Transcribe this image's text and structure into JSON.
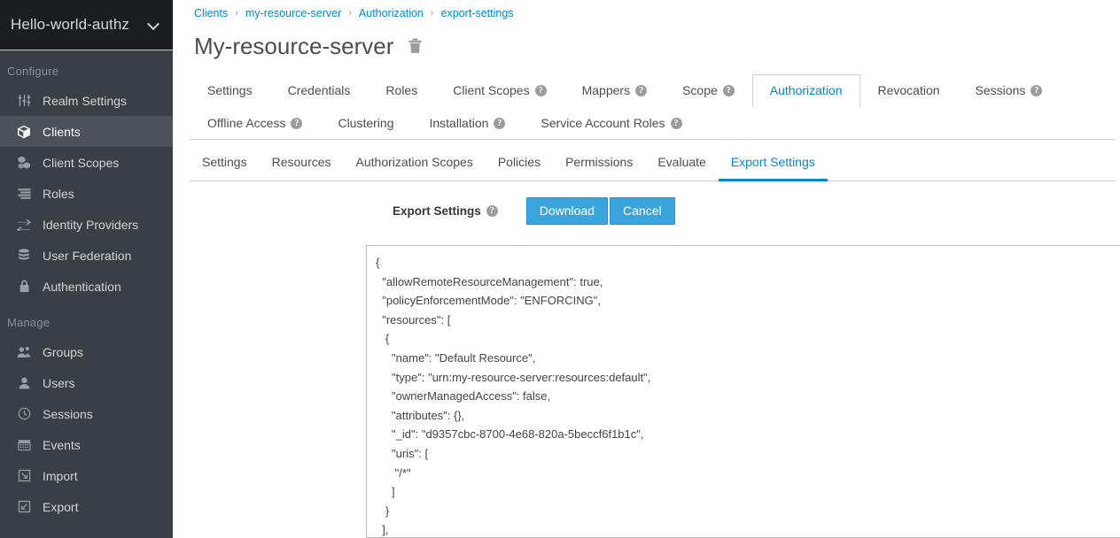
{
  "sidebar": {
    "realm": {
      "name": "Hello-world-authz",
      "chevron_icon": "chevron-down-icon"
    },
    "sections": [
      {
        "label": "Configure",
        "items": [
          {
            "label": "Realm Settings",
            "icon": "sliders-icon",
            "active": false
          },
          {
            "label": "Clients",
            "icon": "cube-icon",
            "active": true
          },
          {
            "label": "Client Scopes",
            "icon": "cubes-icon",
            "active": false
          },
          {
            "label": "Roles",
            "icon": "list-icon",
            "active": false
          },
          {
            "label": "Identity Providers",
            "icon": "exchange-icon",
            "active": false
          },
          {
            "label": "User Federation",
            "icon": "database-icon",
            "active": false
          },
          {
            "label": "Authentication",
            "icon": "lock-icon",
            "active": false
          }
        ]
      },
      {
        "label": "Manage",
        "items": [
          {
            "label": "Groups",
            "icon": "users-icon",
            "active": false
          },
          {
            "label": "Users",
            "icon": "user-icon",
            "active": false
          },
          {
            "label": "Sessions",
            "icon": "clock-icon",
            "active": false
          },
          {
            "label": "Events",
            "icon": "calendar-icon",
            "active": false
          },
          {
            "label": "Import",
            "icon": "import-arrow-icon",
            "active": false
          },
          {
            "label": "Export",
            "icon": "export-arrow-icon",
            "active": false
          }
        ]
      }
    ]
  },
  "breadcrumb": [
    {
      "label": "Clients"
    },
    {
      "label": "my-resource-server"
    },
    {
      "label": "Authorization"
    },
    {
      "label": "export-settings"
    }
  ],
  "breadcrumb_separator": "›",
  "header": {
    "title": "My-resource-server",
    "delete_icon": "trash-icon"
  },
  "primary_tabs": [
    {
      "label": "Settings",
      "help": false,
      "active": false
    },
    {
      "label": "Credentials",
      "help": false,
      "active": false
    },
    {
      "label": "Roles",
      "help": false,
      "active": false
    },
    {
      "label": "Client Scopes",
      "help": true,
      "active": false
    },
    {
      "label": "Mappers",
      "help": true,
      "active": false
    },
    {
      "label": "Scope",
      "help": true,
      "active": false
    },
    {
      "label": "Authorization",
      "help": false,
      "active": true
    },
    {
      "label": "Revocation",
      "help": false,
      "active": false
    },
    {
      "label": "Sessions",
      "help": true,
      "active": false
    },
    {
      "label": "Offline Access",
      "help": true,
      "active": false
    },
    {
      "label": "Clustering",
      "help": false,
      "active": false
    },
    {
      "label": "Installation",
      "help": true,
      "active": false
    },
    {
      "label": "Service Account Roles",
      "help": true,
      "active": false
    }
  ],
  "secondary_tabs": [
    {
      "label": "Settings",
      "active": false
    },
    {
      "label": "Resources",
      "active": false
    },
    {
      "label": "Authorization Scopes",
      "active": false
    },
    {
      "label": "Policies",
      "active": false
    },
    {
      "label": "Permissions",
      "active": false
    },
    {
      "label": "Evaluate",
      "active": false
    },
    {
      "label": "Export Settings",
      "active": true
    }
  ],
  "export_form": {
    "label": "Export Settings",
    "help_icon": "help-circle-icon",
    "download_label": "Download",
    "cancel_label": "Cancel"
  },
  "json_export": {
    "content": "{\n  \"allowRemoteResourceManagement\": true,\n  \"policyEnforcementMode\": \"ENFORCING\",\n  \"resources\": [\n   {\n     \"name\": \"Default Resource\",\n     \"type\": \"urn:my-resource-server:resources:default\",\n     \"ownerManagedAccess\": false,\n     \"attributes\": {},\n     \"_id\": \"d9357cbc-8700-4e68-820a-5beccf6f1b1c\",\n     \"uris\": [\n      \"/*\"\n     ]\n   }\n  ],"
  },
  "colors": {
    "accent": "#0088ce",
    "button": "#39a5dc",
    "sidebar_bg": "#393f44",
    "sidebar_top_bg": "#1b1d21",
    "sidebar_active_bg": "#4d5258"
  }
}
